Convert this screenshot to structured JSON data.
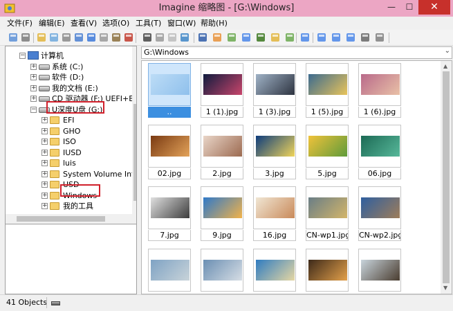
{
  "window": {
    "title": "Imagine 缩略图 - [G:\\Windows]",
    "minimize": "—",
    "maximize": "☐",
    "close": "✕"
  },
  "menu": [
    "文件(F)",
    "编辑(E)",
    "查看(V)",
    "选项(O)",
    "工具(T)",
    "窗口(W)",
    "帮助(H)"
  ],
  "toolbar_icons": [
    "eye-icon",
    "scan-icon",
    "open-folder-icon",
    "copy-files-icon",
    "print-icon",
    "info-icon",
    "save-icon",
    "copy-icon",
    "paste-icon",
    "delete-icon",
    "cut-icon",
    "copy-icon",
    "paste-icon",
    "undo-icon",
    "window-icon",
    "slideshow-icon",
    "filmstrip-icon",
    "grid-icon",
    "image-icon",
    "folder-up-icon",
    "refresh-icon",
    "large-thumbs-icon",
    "details-icon",
    "list-icon",
    "small-icons-icon",
    "tools-icon",
    "settings-icon"
  ],
  "tree": {
    "items": [
      {
        "label": "计算机",
        "icon": "computer-icon",
        "level": 1
      },
      {
        "label": "系统 (C:)",
        "icon": "drive-icon",
        "level": 2
      },
      {
        "label": "软件 (D:)",
        "icon": "drive-icon",
        "level": 2
      },
      {
        "label": "我的文档 (E:)",
        "icon": "drive-icon",
        "level": 2
      },
      {
        "label": "CD 驱动器 (F:) UEFI+BI",
        "icon": "cd-drive-icon",
        "level": 2
      },
      {
        "label": "U深度U盘 (G:)",
        "icon": "usb-drive-icon",
        "level": 2
      },
      {
        "label": "EFI",
        "icon": "folder-icon",
        "level": 3
      },
      {
        "label": "GHO",
        "icon": "folder-icon",
        "level": 3
      },
      {
        "label": "ISO",
        "icon": "folder-icon",
        "level": 3
      },
      {
        "label": "IUSD",
        "icon": "folder-icon",
        "level": 3
      },
      {
        "label": "luis",
        "icon": "folder-icon",
        "level": 3
      },
      {
        "label": "System Volume Inf",
        "icon": "folder-icon",
        "level": 3
      },
      {
        "label": "USD",
        "icon": "folder-icon",
        "level": 3
      },
      {
        "label": "Windows",
        "icon": "folder-icon",
        "level": 3
      },
      {
        "label": "我的工具",
        "icon": "folder-icon",
        "level": 3
      }
    ]
  },
  "path": "G:\\Windows",
  "files": [
    {
      "name": "..",
      "colors": [
        "#bcdcf6",
        "#8fc0ec"
      ],
      "selected": true
    },
    {
      "name": "1 (1).jpg",
      "colors": [
        "#101b3e",
        "#c8456b"
      ],
      "selected": false
    },
    {
      "name": "1 (3).jpg",
      "colors": [
        "#9fb2c6",
        "#2d3340"
      ],
      "selected": false
    },
    {
      "name": "1 (5).jpg",
      "colors": [
        "#3c6b8f",
        "#e8c35a"
      ],
      "selected": false
    },
    {
      "name": "1 (6).jpg",
      "colors": [
        "#b96a8a",
        "#e9c1a7"
      ],
      "selected": false
    },
    {
      "name": "02.jpg",
      "colors": [
        "#7a3a12",
        "#e3a35a"
      ],
      "selected": false
    },
    {
      "name": "2.jpg",
      "colors": [
        "#e9d5c8",
        "#9c6a50"
      ],
      "selected": false
    },
    {
      "name": "3.jpg",
      "colors": [
        "#0d3c7c",
        "#f0d55a"
      ],
      "selected": false
    },
    {
      "name": "5.jpg",
      "colors": [
        "#f0c23a",
        "#5f9b3a"
      ],
      "selected": false
    },
    {
      "name": "06.jpg",
      "colors": [
        "#1c6a55",
        "#57b89a"
      ],
      "selected": false
    },
    {
      "name": "7.jpg",
      "colors": [
        "#e0e0e0",
        "#3d3d3d"
      ],
      "selected": false
    },
    {
      "name": "9.jpg",
      "colors": [
        "#2f79c9",
        "#f1b24a"
      ],
      "selected": false
    },
    {
      "name": "16.jpg",
      "colors": [
        "#f0e6d4",
        "#c98a5a"
      ],
      "selected": false
    },
    {
      "name": "CN-wp1.jpg",
      "colors": [
        "#6a7e86",
        "#d3b56a"
      ],
      "selected": false
    },
    {
      "name": "CN-wp2.jpg",
      "colors": [
        "#2f5f9f",
        "#9e7d5a"
      ],
      "selected": false
    },
    {
      "name": "",
      "colors": [
        "#7fa3c4",
        "#c8d3d9"
      ],
      "selected": false
    },
    {
      "name": "",
      "colors": [
        "#6b8fb3",
        "#d6dde4"
      ],
      "selected": false
    },
    {
      "name": "",
      "colors": [
        "#2f7cc1",
        "#e6d7a3"
      ],
      "selected": false
    },
    {
      "name": "",
      "colors": [
        "#3d2a1a",
        "#e3a04a"
      ],
      "selected": false
    },
    {
      "name": "",
      "colors": [
        "#c8d4dc",
        "#4a3d30"
      ],
      "selected": false
    }
  ],
  "status": {
    "count": "41 Objects"
  }
}
